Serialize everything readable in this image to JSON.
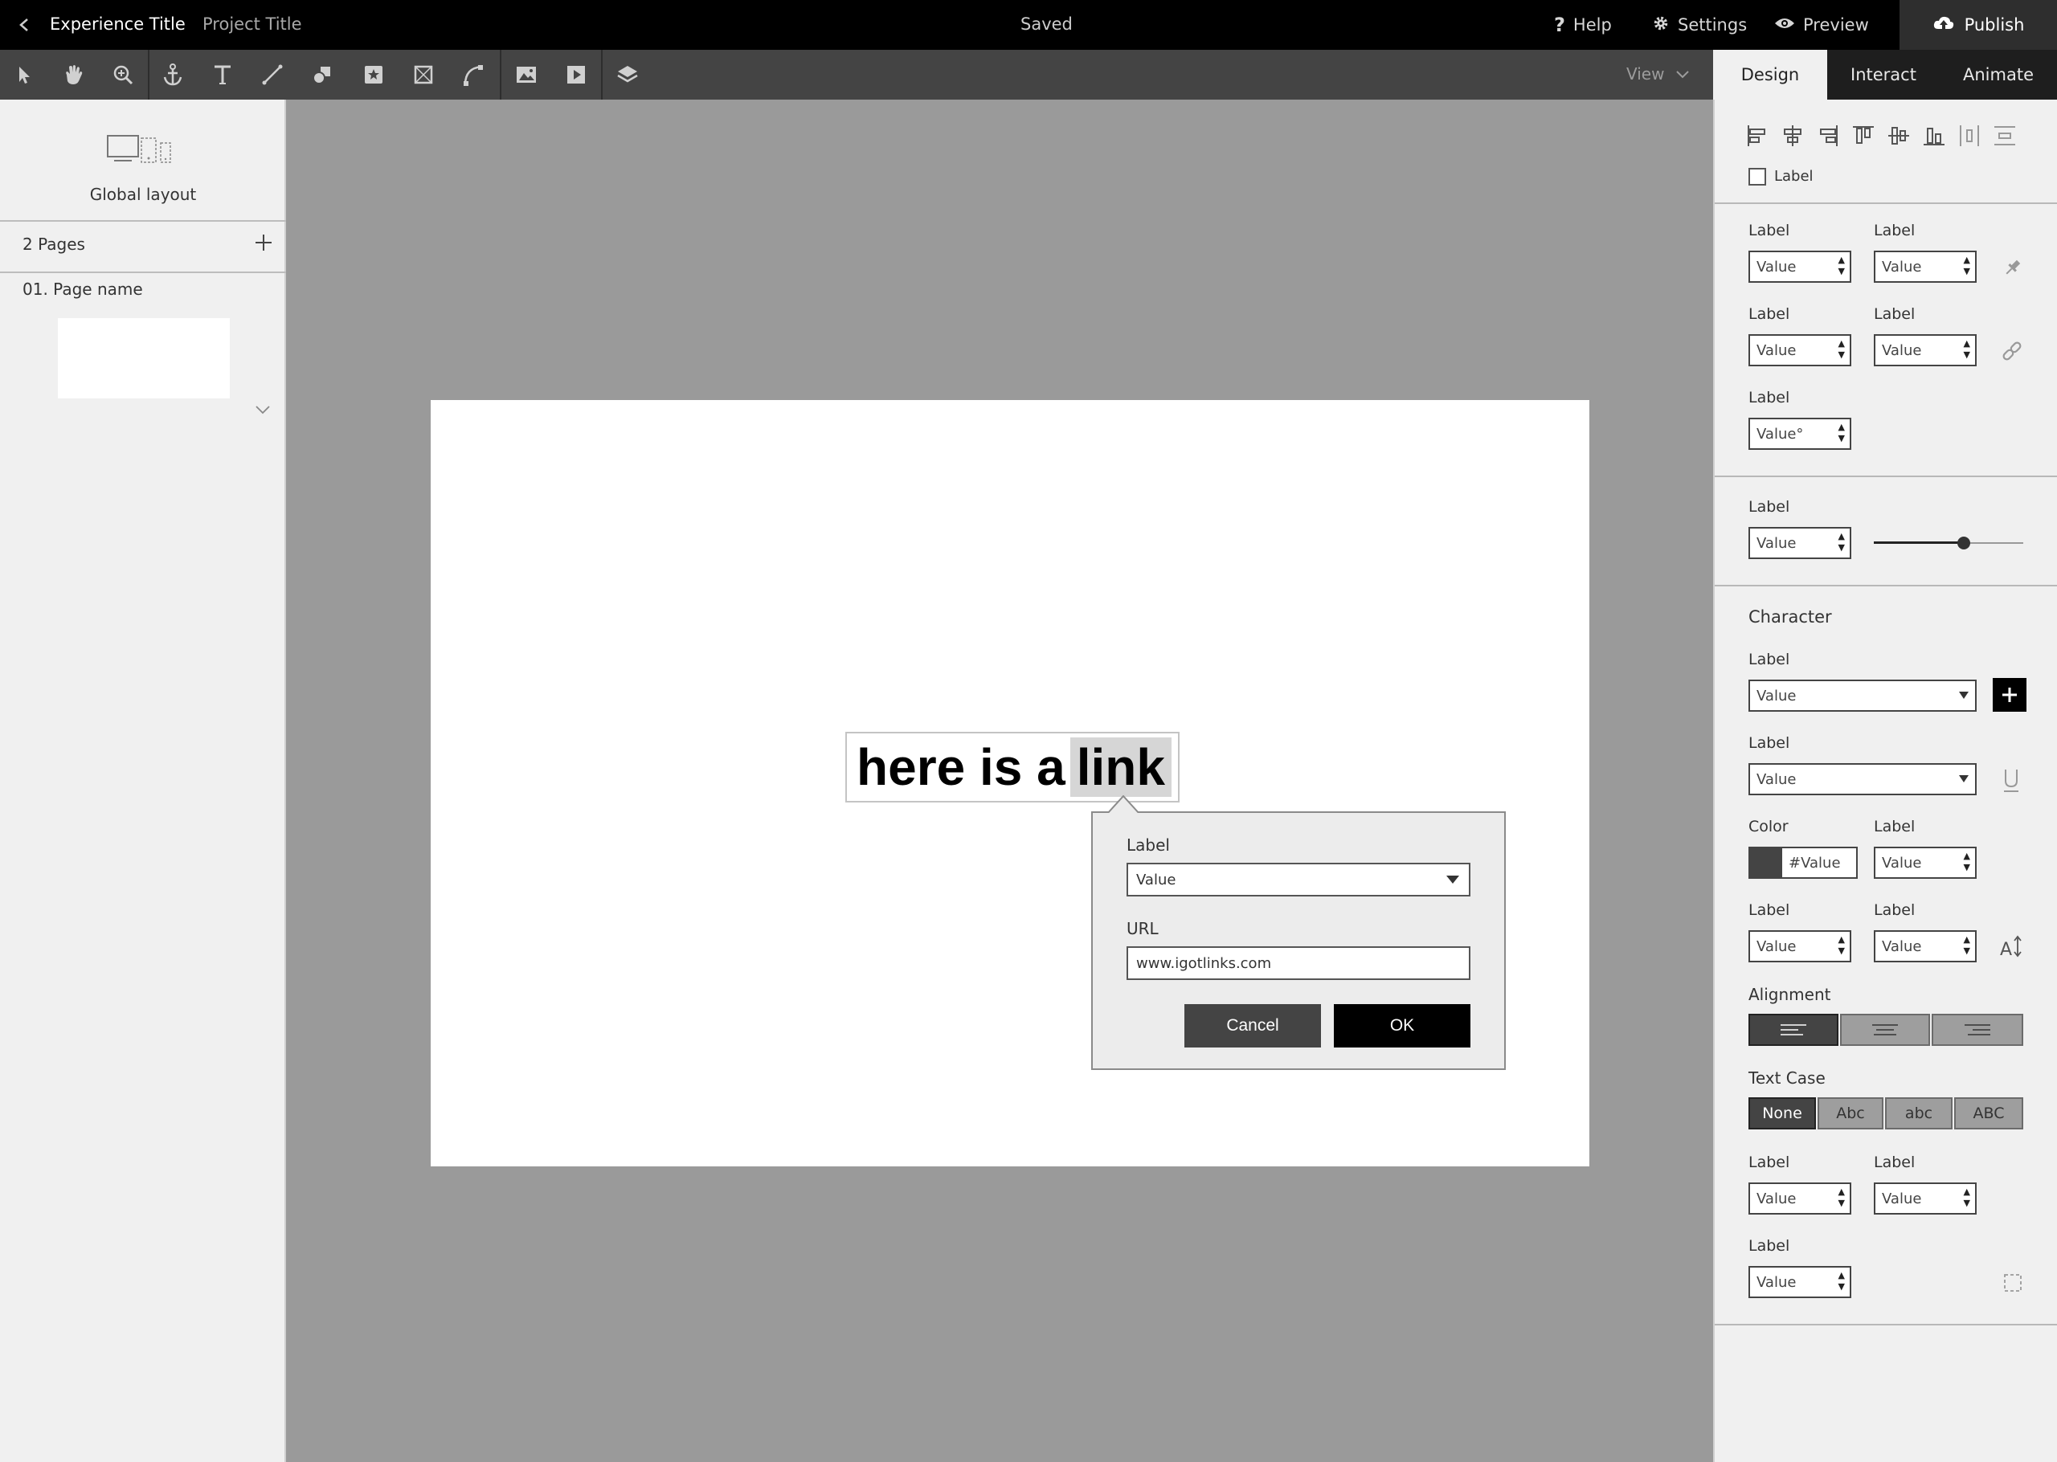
{
  "topbar": {
    "experience_title": "Experience Title",
    "project_title": "Project Title",
    "status": "Saved",
    "help_label": "Help",
    "settings_label": "Settings",
    "preview_label": "Preview",
    "publish_label": "Publish"
  },
  "toolbar": {
    "tools": [
      "select-tool",
      "hand-tool",
      "zoom-tool",
      "anchor-tool",
      "text-tool",
      "line-tool",
      "shapes-tool",
      "symbol-tool",
      "crop-tool",
      "pen-tool",
      "image-tool",
      "video-tool",
      "layers-tool"
    ],
    "view_label": "View"
  },
  "tabs": [
    {
      "label": "Design",
      "active": true
    },
    {
      "label": "Interact",
      "active": false
    },
    {
      "label": "Animate",
      "active": false
    }
  ],
  "left_panel": {
    "global_layout_label": "Global layout",
    "pages_count": "2 Pages",
    "page_name": "01. Page name"
  },
  "canvas": {
    "text_plain": "here is a",
    "text_link": "link"
  },
  "link_popover": {
    "type_label": "Label",
    "type_value": "Value",
    "url_label": "URL",
    "url_value": "www.igotlinks.com",
    "cancel_label": "Cancel",
    "ok_label": "OK"
  },
  "right_panel": {
    "checkbox_label": "Label",
    "field_label": "Label",
    "value": "Value",
    "rotation_value": "Value°",
    "slider_value": 0.6,
    "character_heading": "Character",
    "color_label": "Color",
    "color_value": "#Value",
    "color_swatch": "#444444",
    "alignment_heading": "Alignment",
    "text_case_heading": "Text Case",
    "text_case_options": [
      "None",
      "Abc",
      "abc",
      "ABC"
    ]
  }
}
